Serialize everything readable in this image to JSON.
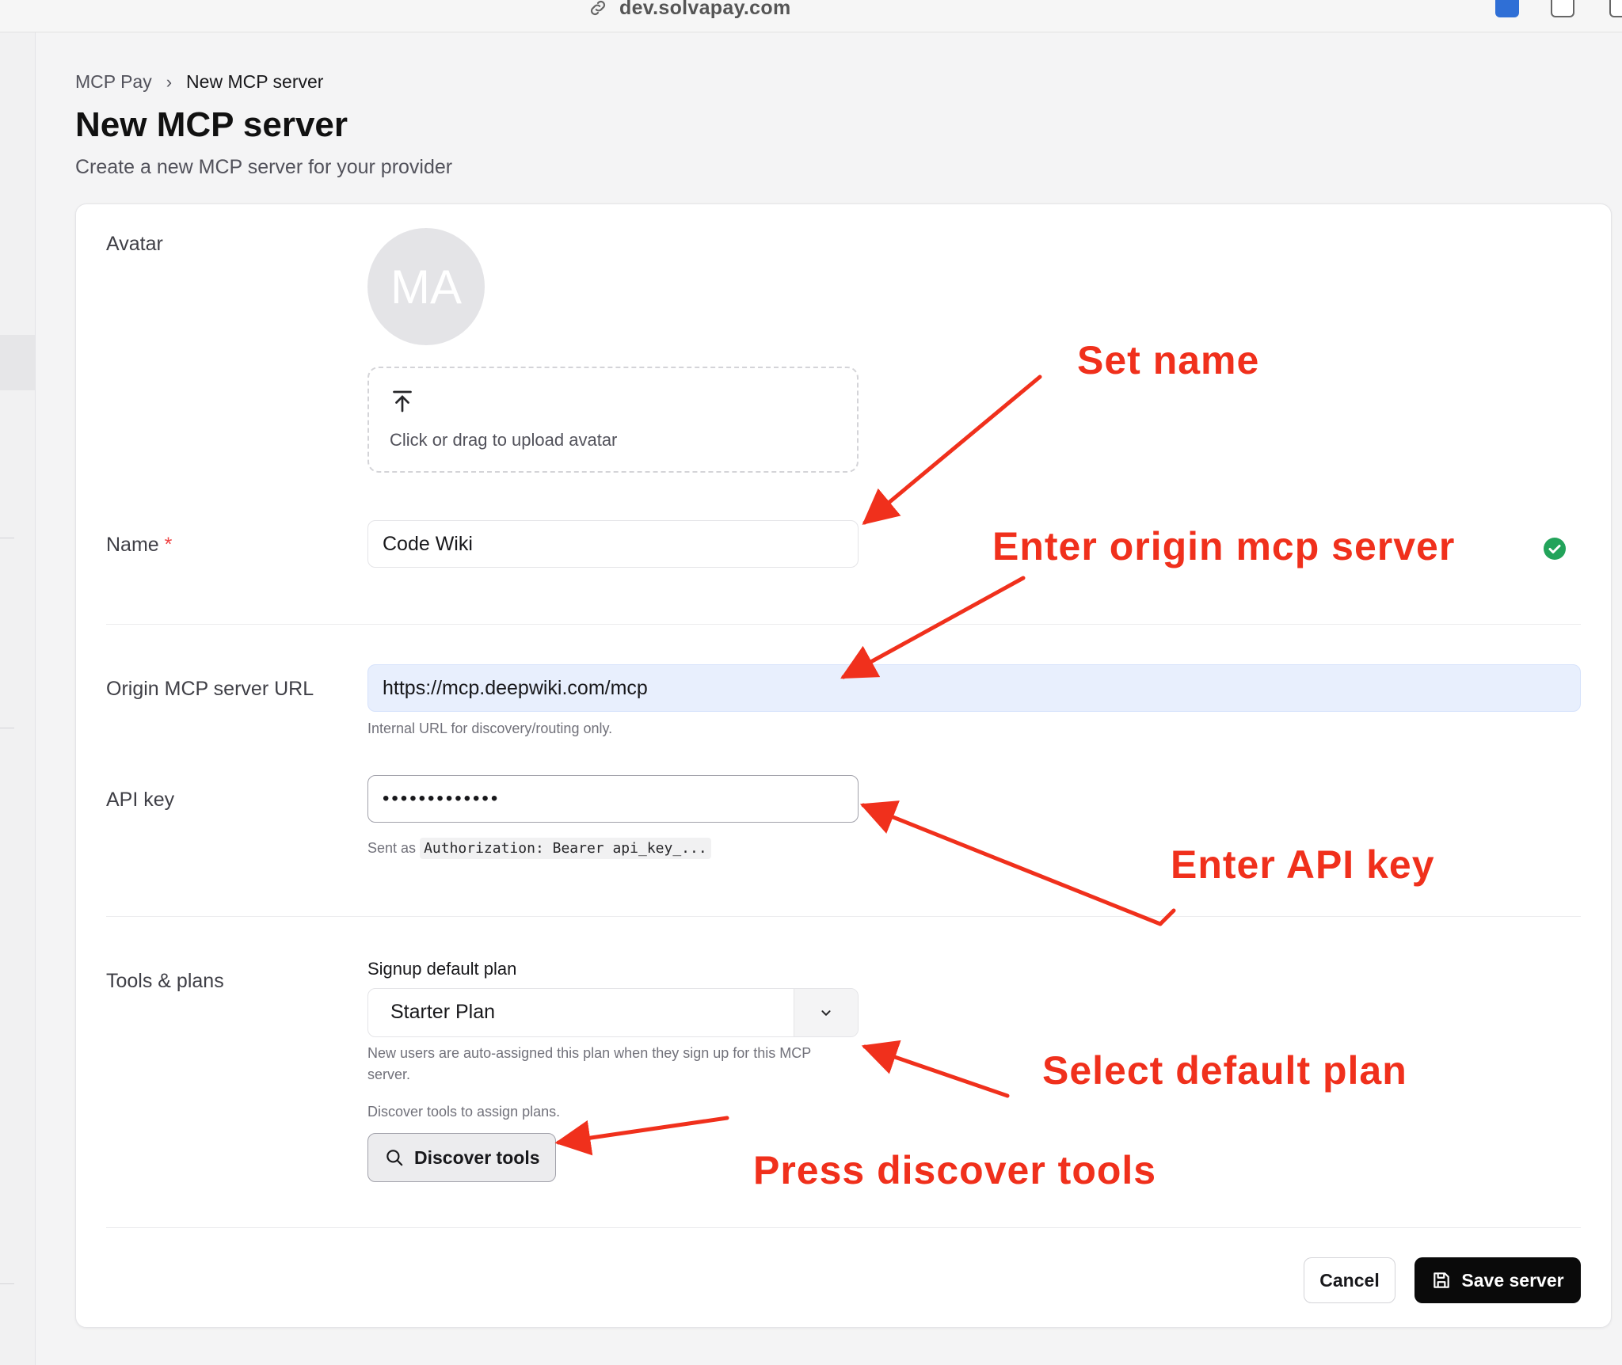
{
  "browser": {
    "url": "dev.solvapay.com"
  },
  "breadcrumb": {
    "parent": "MCP Pay",
    "current": "New MCP server"
  },
  "page": {
    "title": "New MCP server",
    "subtitle": "Create a new MCP server for your provider"
  },
  "form": {
    "avatar": {
      "label": "Avatar",
      "initials": "MA",
      "upload_text": "Click or drag to upload avatar"
    },
    "name": {
      "label": "Name",
      "required_mark": "*",
      "value": "Code Wiki"
    },
    "origin": {
      "label": "Origin MCP server URL",
      "value": "https://mcp.deepwiki.com/mcp",
      "hint": "Internal URL for discovery/routing only."
    },
    "api_key": {
      "label": "API key",
      "value": "•••••••••••••",
      "hint_prefix": "Sent as",
      "hint_code": "Authorization: Bearer api_key_..."
    },
    "tools": {
      "label": "Tools & plans",
      "plan_label": "Signup default plan",
      "plan_value": "Starter Plan",
      "plan_hint_line1": "New users are auto-assigned this plan when they sign up for this MCP",
      "plan_hint_line2": "server.",
      "discover_hint": "Discover tools to assign plans.",
      "discover_button": "Discover tools"
    }
  },
  "actions": {
    "cancel": "Cancel",
    "save": "Save server"
  },
  "annotations": {
    "set_name": "Set name",
    "enter_origin": "Enter origin mcp server",
    "enter_api_key": "Enter API key",
    "select_plan": "Select default plan",
    "press_discover": "Press discover tools"
  },
  "colors": {
    "annotation": "#f0301c",
    "valid": "#22a35a",
    "primary_button": "#0a0a0a",
    "url_field_bg": "#e8effd"
  }
}
